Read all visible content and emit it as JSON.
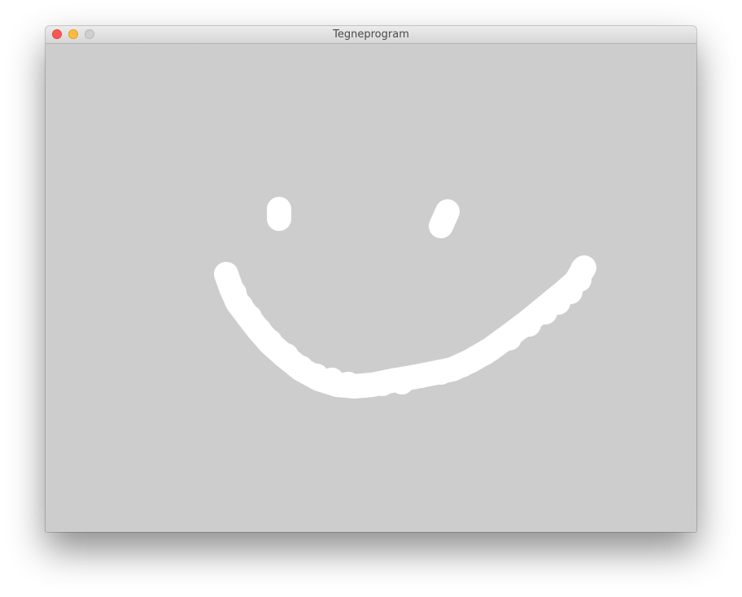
{
  "window": {
    "title": "Tegneprogram",
    "buttons": {
      "close_icon": "close-icon",
      "minimize_icon": "minimize-icon",
      "zoom_icon": "zoom-icon"
    }
  },
  "canvas": {
    "background": "#cdcdcd",
    "stroke_color": "#ffffff",
    "drawing": "smiley"
  }
}
